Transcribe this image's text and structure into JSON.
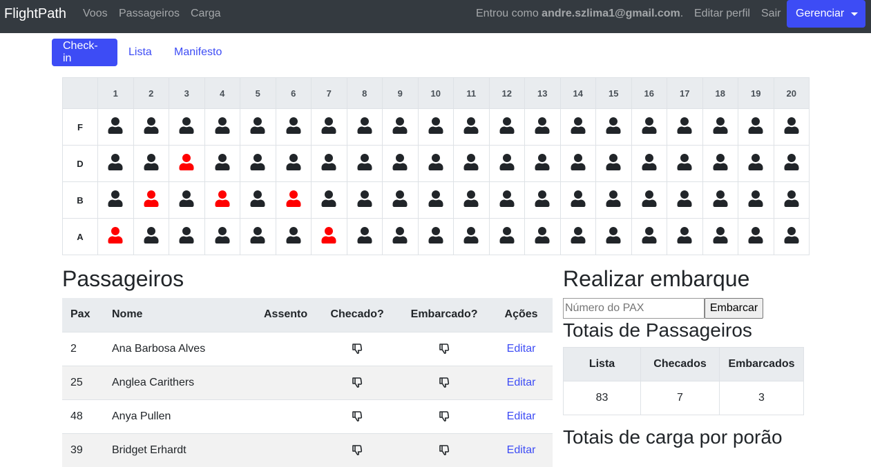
{
  "navbar": {
    "brand": "FlightPath",
    "links": [
      "Voos",
      "Passageiros",
      "Carga"
    ],
    "logged_prefix": "Entrou como",
    "user_email": "andre.szlima1@gmail.com",
    "logged_suffix": ".",
    "edit_profile": "Editar perfil",
    "logout": "Sair",
    "manage": "Gerenciar"
  },
  "tabs": [
    "Check-in",
    "Lista",
    "Manifesto"
  ],
  "seatmap": {
    "columns": [
      "1",
      "2",
      "3",
      "4",
      "5",
      "6",
      "7",
      "8",
      "9",
      "10",
      "11",
      "12",
      "13",
      "14",
      "15",
      "16",
      "17",
      "18",
      "19",
      "20"
    ],
    "rows": [
      {
        "label": "F",
        "occupied_red": []
      },
      {
        "label": "D",
        "occupied_red": [
          3
        ]
      },
      {
        "label": "B",
        "occupied_red": [
          2,
          4,
          6
        ]
      },
      {
        "label": "A",
        "occupied_red": [
          1,
          7
        ]
      }
    ],
    "colors": {
      "default": "#212529",
      "highlight": "#ff0000"
    }
  },
  "passengers": {
    "title": "Passageiros",
    "headers": [
      "Pax",
      "Nome",
      "Assento",
      "Checado?",
      "Embarcado?",
      "Ações"
    ],
    "rows": [
      {
        "pax": "2",
        "name": "Ana Barbosa Alves",
        "seat": "",
        "action": "Editar"
      },
      {
        "pax": "25",
        "name": "Anglea Carithers",
        "seat": "",
        "action": "Editar"
      },
      {
        "pax": "48",
        "name": "Anya Pullen",
        "seat": "",
        "action": "Editar"
      },
      {
        "pax": "39",
        "name": "Bridget Erhardt",
        "seat": "",
        "action": "Editar"
      }
    ]
  },
  "boarding": {
    "title": "Realizar embarque",
    "placeholder": "Número do PAX",
    "button": "Embarcar"
  },
  "totals": {
    "title": "Totais de Passageiros",
    "headers": [
      "Lista",
      "Checados",
      "Embarcados"
    ],
    "values": [
      "83",
      "7",
      "3"
    ]
  },
  "cargo": {
    "title": "Totais de carga por porão"
  },
  "accent": "#3d4cf5"
}
